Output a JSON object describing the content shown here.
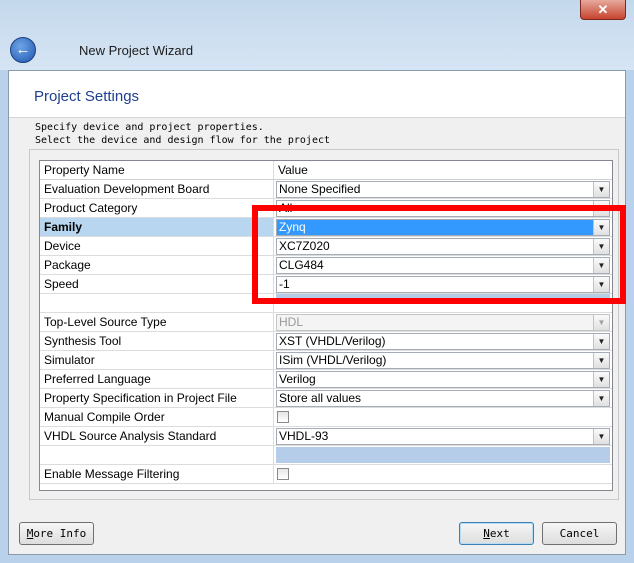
{
  "window": {
    "title": "New Project Wizard",
    "close_label": "✕"
  },
  "page": {
    "title": "Project Settings",
    "desc1": "Specify device and project properties.",
    "desc2": "Select the device and design flow for the project"
  },
  "grid": {
    "header_name": "Property Name",
    "header_value": "Value",
    "rows": [
      {
        "name": "Evaluation Development Board",
        "value": "None Specified"
      },
      {
        "name": "Product Category",
        "value": "All"
      },
      {
        "name": "Family",
        "value": "Zynq"
      },
      {
        "name": "Device",
        "value": "XC7Z020"
      },
      {
        "name": "Package",
        "value": "CLG484"
      },
      {
        "name": "Speed",
        "value": "-1"
      },
      {
        "name": "",
        "value": ""
      },
      {
        "name": "Top-Level Source Type",
        "value": "HDL"
      },
      {
        "name": "Synthesis Tool",
        "value": "XST (VHDL/Verilog)"
      },
      {
        "name": "Simulator",
        "value": "ISim (VHDL/Verilog)"
      },
      {
        "name": "Preferred Language",
        "value": "Verilog"
      },
      {
        "name": "Property Specification in Project File",
        "value": "Store all values"
      },
      {
        "name": "Manual Compile Order",
        "value": ""
      },
      {
        "name": "VHDL Source Analysis Standard",
        "value": "VHDL-93"
      },
      {
        "name": "",
        "value": ""
      },
      {
        "name": "Enable Message Filtering",
        "value": ""
      }
    ]
  },
  "buttons": {
    "more_info_first": "M",
    "more_info_rest": "ore Info",
    "next_first": "N",
    "next_rest": "ext",
    "cancel": "Cancel"
  },
  "icons": {
    "back": "back-arrow-icon",
    "dropdown": "dropdown-arrow-icon"
  },
  "colors": {
    "highlight": "#ff0000",
    "selection": "#3399ff",
    "title": "#1e3f8f"
  }
}
